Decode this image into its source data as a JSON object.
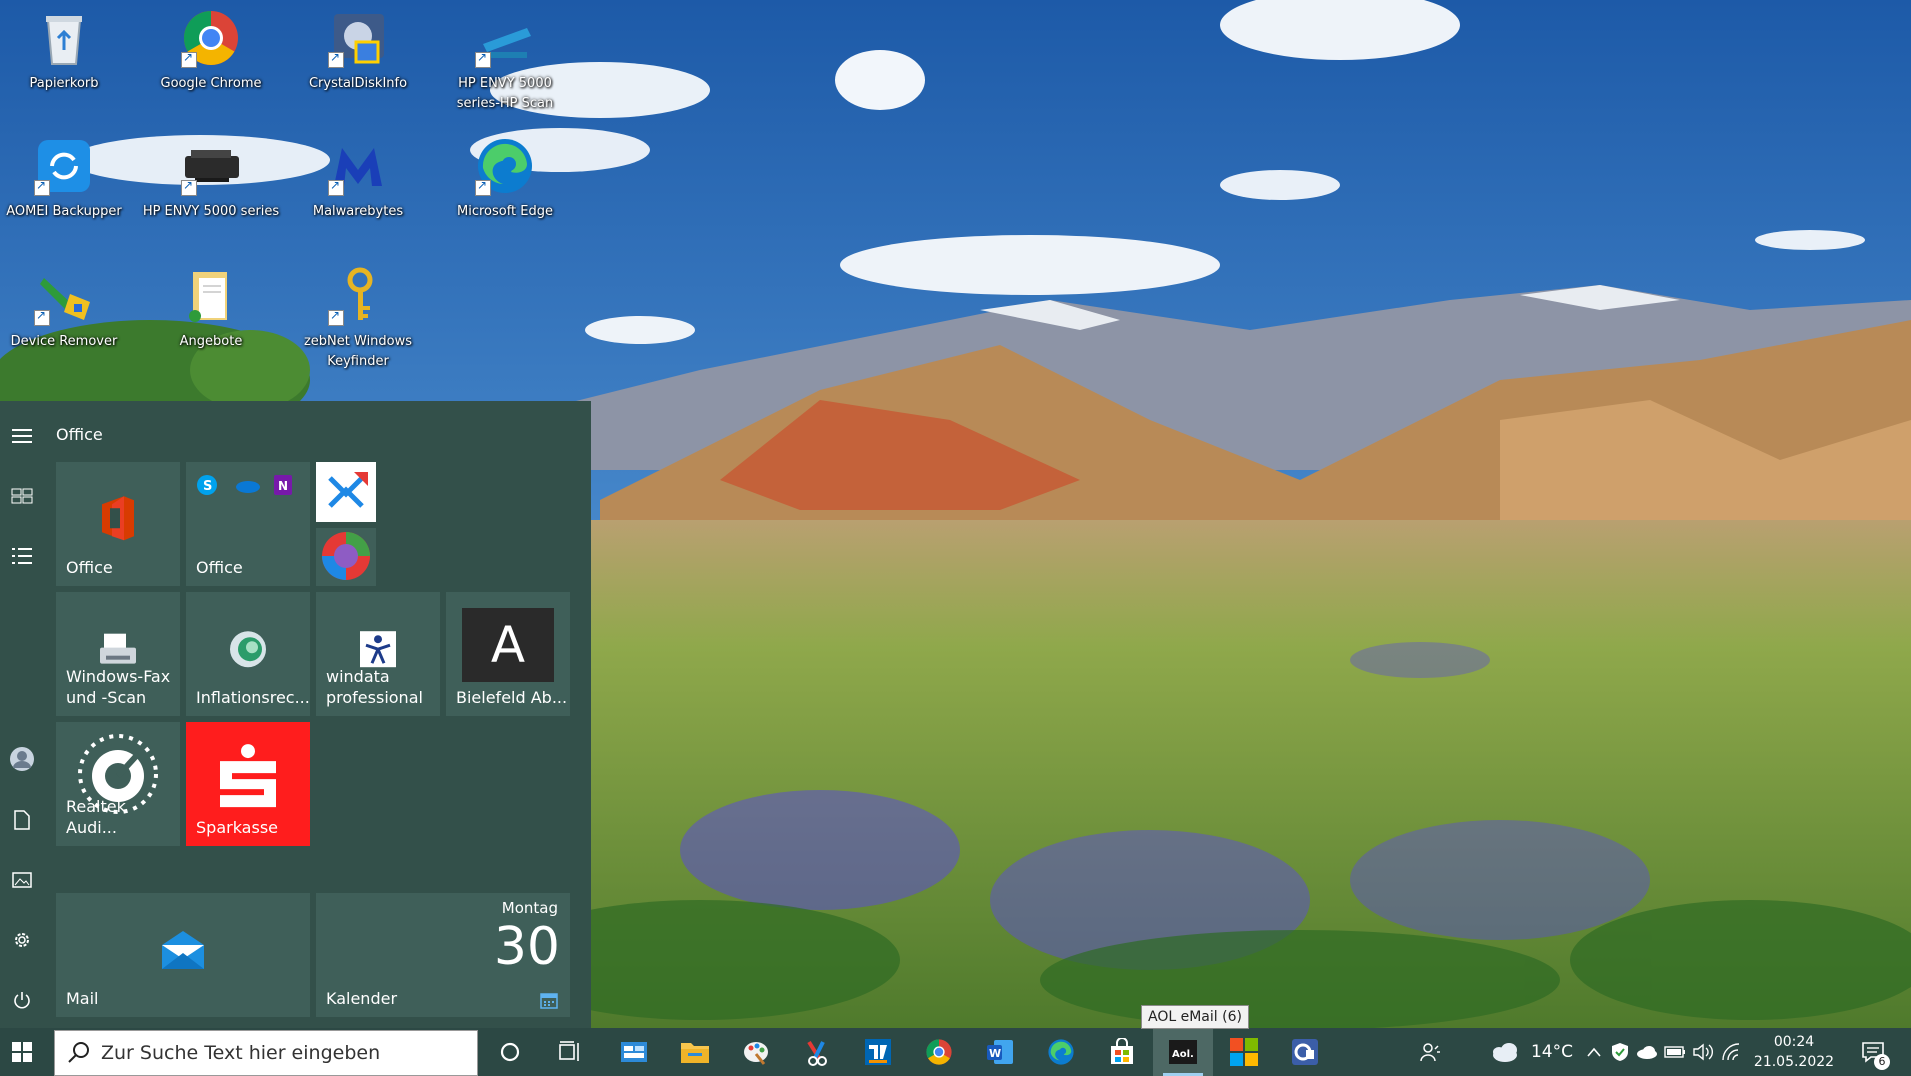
{
  "desktop_icons": [
    {
      "label": "Papierkorb",
      "icon": "recycle-bin-icon"
    },
    {
      "label": "Google Chrome",
      "icon": "chrome-icon"
    },
    {
      "label": "CrystalDiskInfo",
      "icon": "crystaldiskinfo-icon"
    },
    {
      "label": "HP ENVY 5000 series-HP Scan",
      "icon": "scanner-icon"
    },
    {
      "label": "AOMEI Backupper",
      "icon": "aomei-backupper-icon"
    },
    {
      "label": "HP ENVY 5000 series",
      "icon": "printer-icon"
    },
    {
      "label": "Malwarebytes",
      "icon": "malwarebytes-icon"
    },
    {
      "label": "Microsoft Edge",
      "icon": "edge-icon"
    },
    {
      "label": "Device Remover",
      "icon": "device-remover-icon"
    },
    {
      "label": "Angebote",
      "icon": "folder-document-icon"
    },
    {
      "label": "zebNet Windows Keyfinder",
      "icon": "key-icon"
    }
  ],
  "start_menu": {
    "group_title": "Office",
    "tiles": {
      "office1": "Office",
      "office2": "Office",
      "fax": "Windows-Fax und -Scan",
      "inflation": "Inflationsrec...",
      "windata": "windata professional",
      "bielefeld": "Bielefeld Ab...",
      "bielefeld_letter": "A",
      "realtek": "Realtek Audi...",
      "sparkasse": "Sparkasse",
      "mail": "Mail",
      "calendar": "Kalender",
      "calendar_day": "Montag",
      "calendar_date": "30"
    }
  },
  "taskbar": {
    "search_placeholder": "Zur Suche Text hier eingeben",
    "weather_temp": "14°C",
    "time": "00:24",
    "date": "21.05.2022",
    "notification_count": "6",
    "tooltip": "AOL eMail (6)"
  },
  "colors": {
    "start_bg": "#33504a",
    "tile_bg": "#3f5f59",
    "taskbar_bg": "#2c4844",
    "sparkasse_red": "#ff1d1d"
  }
}
